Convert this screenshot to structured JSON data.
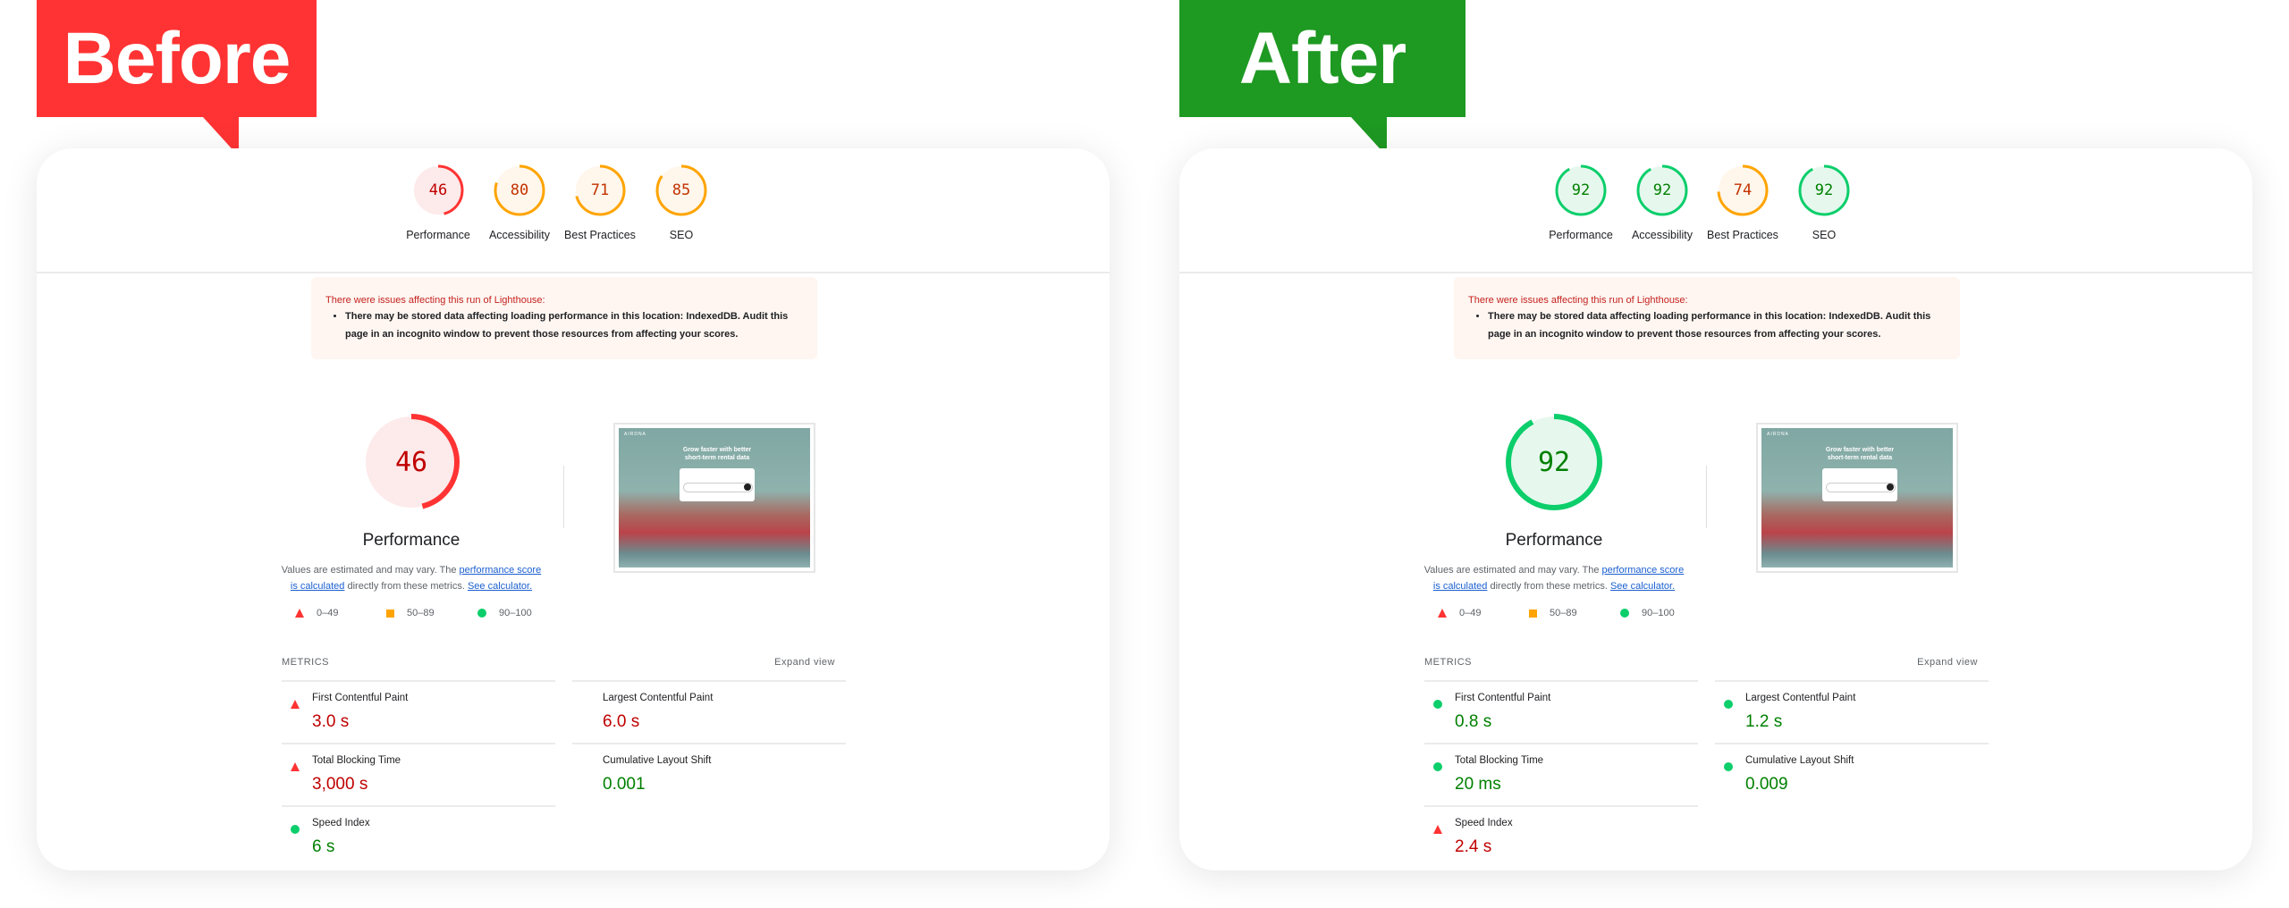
{
  "colors": {
    "fail": "#ff3333",
    "fail_text": "#c00000",
    "fail_bg": "#fdeaea",
    "average": "#ffa400",
    "average_text": "#c33300",
    "average_bg": "#fff6ec",
    "pass": "#0cce6b",
    "pass_text": "#008000",
    "pass_bg": "#e6f8ee",
    "before_tag": "#ff3333",
    "after_tag": "#1e9922"
  },
  "panels": [
    {
      "tag": "Before",
      "categories": [
        {
          "label": "Performance",
          "score": 46,
          "rating": "fail"
        },
        {
          "label": "Accessibility",
          "score": 80,
          "rating": "average"
        },
        {
          "label": "Best Practices",
          "score": 71,
          "rating": "average"
        },
        {
          "label": "SEO",
          "score": 85,
          "rating": "average"
        }
      ],
      "warning": {
        "title": "There were issues affecting this run of Lighthouse:",
        "item": "There may be stored data affecting loading performance in this location: IndexedDB. Audit this page in an incognito window to prevent those resources from affecting your scores."
      },
      "performance": {
        "score": 46,
        "rating": "fail",
        "title": "Performance"
      },
      "description": {
        "prefix": "Values are estimated and may vary. The ",
        "link1": "performance score is calculated",
        "middle": " directly from these metrics. ",
        "link2": "See calculator."
      },
      "legend": [
        {
          "icon": "triangle-icon",
          "range": "0–49"
        },
        {
          "icon": "square-icon",
          "range": "50–89"
        },
        {
          "icon": "circle-icon",
          "range": "90–100"
        }
      ],
      "thumbnail": {
        "logo": "AIRDNA",
        "headline": "Grow faster with better short-term rental data"
      },
      "metrics_title": "METRICS",
      "expand": "Expand view",
      "metrics": [
        {
          "label": "First Contentful Paint",
          "value": "3.0 s",
          "rating": "fail",
          "icon": "triangle"
        },
        {
          "label": "Largest Contentful Paint",
          "value": "6.0 s",
          "rating": "fail",
          "icon": null
        },
        {
          "label": "Total Blocking Time",
          "value": "3,000 s",
          "rating": "fail",
          "icon": "triangle"
        },
        {
          "label": "Cumulative Layout Shift",
          "value": "0.001",
          "rating": "pass",
          "icon": null
        },
        {
          "label": "Speed Index",
          "value": "6 s",
          "rating": "pass",
          "icon": "circle"
        }
      ]
    },
    {
      "tag": "After",
      "categories": [
        {
          "label": "Performance",
          "score": 92,
          "rating": "pass"
        },
        {
          "label": "Accessibility",
          "score": 92,
          "rating": "pass"
        },
        {
          "label": "Best Practices",
          "score": 74,
          "rating": "average"
        },
        {
          "label": "SEO",
          "score": 92,
          "rating": "pass"
        }
      ],
      "warning": {
        "title": "There were issues affecting this run of Lighthouse:",
        "item": "There may be stored data affecting loading performance in this location: IndexedDB. Audit this page in an incognito window to prevent those resources from affecting your scores."
      },
      "performance": {
        "score": 92,
        "rating": "pass",
        "title": "Performance"
      },
      "description": {
        "prefix": "Values are estimated and may vary. The ",
        "link1": "performance score is calculated",
        "middle": " directly from these metrics. ",
        "link2": "See calculator."
      },
      "legend": [
        {
          "icon": "triangle-icon",
          "range": "0–49"
        },
        {
          "icon": "square-icon",
          "range": "50–89"
        },
        {
          "icon": "circle-icon",
          "range": "90–100"
        }
      ],
      "thumbnail": {
        "logo": "AIRDNA",
        "headline": "Grow faster with better short-term rental data"
      },
      "metrics_title": "METRICS",
      "expand": "Expand view",
      "metrics": [
        {
          "label": "First Contentful Paint",
          "value": "0.8 s",
          "rating": "pass",
          "icon": "circle"
        },
        {
          "label": "Largest Contentful Paint",
          "value": "1.2 s",
          "rating": "pass",
          "icon": "circle"
        },
        {
          "label": "Total Blocking Time",
          "value": "20 ms",
          "rating": "pass",
          "icon": "circle"
        },
        {
          "label": "Cumulative Layout Shift",
          "value": "0.009",
          "rating": "pass",
          "icon": "circle"
        },
        {
          "label": "Speed Index",
          "value": "2.4 s",
          "rating": "fail",
          "icon": "triangle"
        }
      ]
    }
  ]
}
